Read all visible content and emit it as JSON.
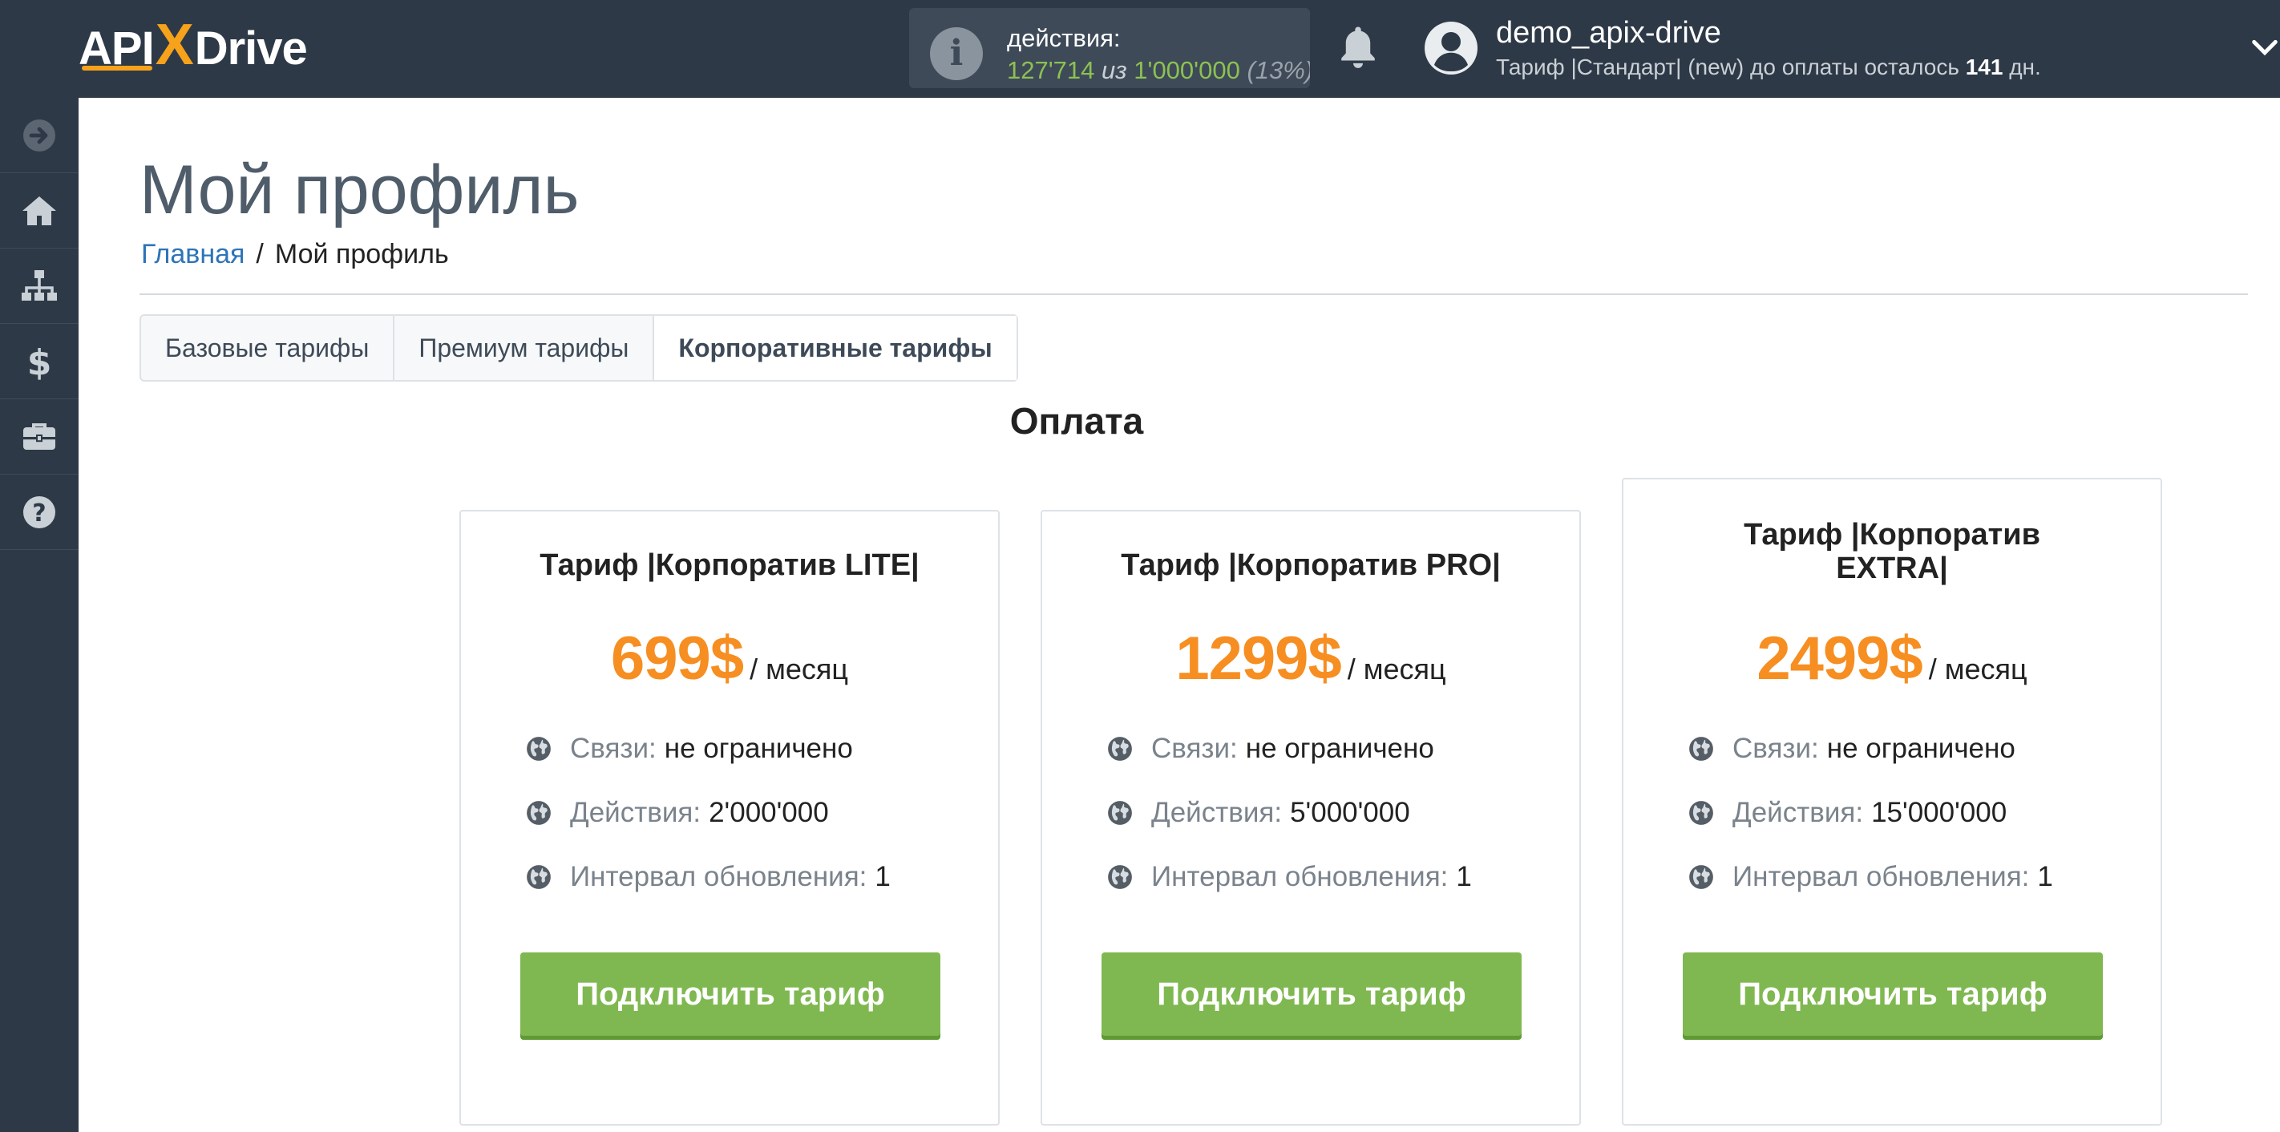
{
  "app": {
    "logo_api": "API",
    "logo_x": "X",
    "logo_drive": "Drive"
  },
  "header": {
    "actions_label": "действия:",
    "actions_used": "127'714",
    "actions_of": "из",
    "actions_total": "1'000'000",
    "actions_pct": "(13%)",
    "user_name": "demo_apix-drive",
    "tariff_text": "Тариф |Стандарт| (new) до оплаты осталось",
    "tariff_days": "141",
    "tariff_days_unit": "дн."
  },
  "sidebar": {
    "items": [
      {
        "icon": "arrow-right-circle-icon"
      },
      {
        "icon": "home-icon"
      },
      {
        "icon": "sitemap-icon"
      },
      {
        "icon": "dollar-icon"
      },
      {
        "icon": "briefcase-icon"
      },
      {
        "icon": "question-circle-icon"
      }
    ]
  },
  "page": {
    "title": "Мой профиль",
    "breadcrumb_home": "Главная",
    "breadcrumb_sep": "/",
    "breadcrumb_current": "Мой профиль"
  },
  "tabs": [
    {
      "label": "Базовые тарифы",
      "active": false
    },
    {
      "label": "Премиум тарифы",
      "active": false
    },
    {
      "label": "Корпоративные тарифы",
      "active": true
    }
  ],
  "section": {
    "title": "Оплата"
  },
  "plans": [
    {
      "title": "Тариф |Корпоратив LITE|",
      "price": "699$",
      "per": "/ месяц",
      "features": [
        {
          "label": "Связи:",
          "value": "не ограничено"
        },
        {
          "label": "Действия:",
          "value": "2'000'000"
        },
        {
          "label": "Интервал обновления:",
          "value": "1"
        }
      ],
      "button": "Подключить тариф"
    },
    {
      "title": "Тариф |Корпоратив PRO|",
      "price": "1299$",
      "per": "/ месяц",
      "features": [
        {
          "label": "Связи:",
          "value": "не ограничено"
        },
        {
          "label": "Действия:",
          "value": "5'000'000"
        },
        {
          "label": "Интервал обновления:",
          "value": "1"
        }
      ],
      "button": "Подключить тариф"
    },
    {
      "title": "Тариф |Корпоратив EXTRA|",
      "price": "2499$",
      "per": "/ месяц",
      "features": [
        {
          "label": "Связи:",
          "value": "не ограничено"
        },
        {
          "label": "Действия:",
          "value": "15'000'000"
        },
        {
          "label": "Интервал обновления:",
          "value": "1"
        }
      ],
      "button": "Подключить тариф"
    }
  ],
  "colors": {
    "topbar": "#2e3947",
    "accent_orange": "#f68e21",
    "button_green": "#7fb850",
    "link_blue": "#2d74b8",
    "actions_green": "#8cc152"
  }
}
